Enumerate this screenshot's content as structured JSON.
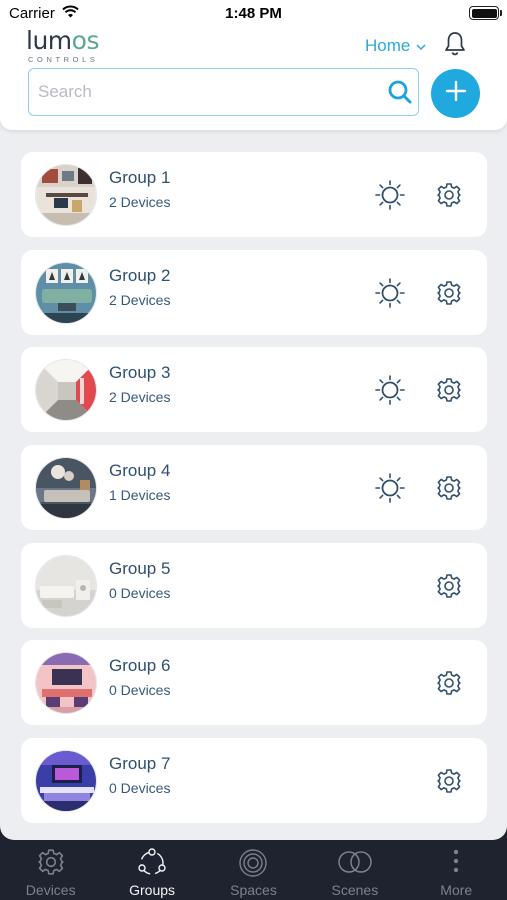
{
  "status_bar": {
    "carrier": "Carrier",
    "time": "1:48 PM"
  },
  "header": {
    "logo_main_prefix": "lum",
    "logo_main_suffix": "os",
    "logo_sub": "CONTROLS",
    "home_label": "Home",
    "search_placeholder": "Search",
    "accent_color": "#20a9df"
  },
  "groups": [
    {
      "name": "Group 1",
      "devices": "2 Devices",
      "has_dimmer": true
    },
    {
      "name": "Group 2",
      "devices": "2 Devices",
      "has_dimmer": true
    },
    {
      "name": "Group 3",
      "devices": "2 Devices",
      "has_dimmer": true
    },
    {
      "name": "Group 4",
      "devices": "1 Devices",
      "has_dimmer": true
    },
    {
      "name": "Group 5",
      "devices": "0 Devices",
      "has_dimmer": false
    },
    {
      "name": "Group 6",
      "devices": "0 Devices",
      "has_dimmer": false
    },
    {
      "name": "Group 7",
      "devices": "0 Devices",
      "has_dimmer": false
    }
  ],
  "tabs": [
    {
      "label": "Devices",
      "icon": "gear-icon",
      "active": false
    },
    {
      "label": "Groups",
      "icon": "groups-icon",
      "active": true
    },
    {
      "label": "Spaces",
      "icon": "spaces-icon",
      "active": false
    },
    {
      "label": "Scenes",
      "icon": "scenes-icon",
      "active": false
    },
    {
      "label": "More",
      "icon": "more-dots-icon",
      "active": false
    }
  ]
}
